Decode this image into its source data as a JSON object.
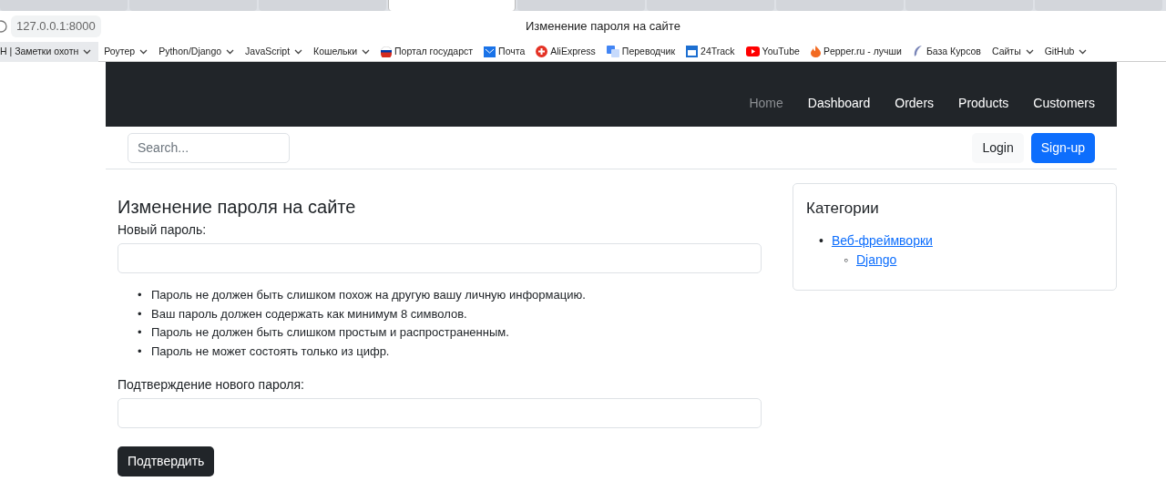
{
  "browser": {
    "tabs": [
      {
        "selected": false
      },
      {
        "selected": false
      },
      {
        "selected": false
      },
      {
        "selected": true
      },
      {
        "selected": false
      },
      {
        "selected": false
      },
      {
        "selected": false
      },
      {
        "selected": false
      },
      {
        "selected": false
      }
    ],
    "address": "127.0.0.1:8000",
    "page_title": "Изменение пароля на сайте",
    "bookmarks": [
      {
        "label": "Н | Заметки охотн",
        "kind": "folder"
      },
      {
        "label": "Роутер",
        "kind": "folder"
      },
      {
        "label": "Python/Django",
        "kind": "folder"
      },
      {
        "label": "JavaScript",
        "kind": "folder"
      },
      {
        "label": "Кошельки",
        "kind": "folder"
      },
      {
        "label": "Портал государст",
        "kind": "flag"
      },
      {
        "label": "Почта",
        "kind": "mail"
      },
      {
        "label": "AliExpress",
        "kind": "ali"
      },
      {
        "label": "Переводчик",
        "kind": "translate"
      },
      {
        "label": "24Track",
        "kind": "track"
      },
      {
        "label": "YouTube",
        "kind": "youtube"
      },
      {
        "label": "Pepper.ru - лучши",
        "kind": "fire"
      },
      {
        "label": "База Курсов",
        "kind": "feather"
      },
      {
        "label": "Сайты",
        "kind": "folder"
      },
      {
        "label": "GitHub",
        "kind": "folder"
      }
    ]
  },
  "navbar": {
    "links": [
      {
        "label": "Home",
        "selected": true
      },
      {
        "label": "Dashboard",
        "selected": false
      },
      {
        "label": "Orders",
        "selected": false
      },
      {
        "label": "Products",
        "selected": false
      },
      {
        "label": "Customers",
        "selected": false
      }
    ]
  },
  "toolbar": {
    "search": {
      "placeholder": "Search..."
    },
    "login": "Login",
    "signup": "Sign-up"
  },
  "form": {
    "title": "Изменение пароля на сайте",
    "new_password_label": "Новый пароль:",
    "bullet": "•",
    "help": [
      "Пароль не должен быть слишком похож на другую вашу личную информацию.",
      "Ваш пароль должен содержать как минимум 8 символов.",
      "Пароль не должен быть слишком простым и распространенным.",
      "Пароль не может состоять только из цифр."
    ],
    "confirm_label": "Подтверждение нового пароля:",
    "submit": "Подтвердить"
  },
  "sidebar": {
    "title": "Категории",
    "items": [
      {
        "bullet": "•",
        "label": "Веб-фреймворки",
        "children": [
          {
            "bullet": "◦",
            "label": "Django"
          }
        ]
      }
    ]
  }
}
